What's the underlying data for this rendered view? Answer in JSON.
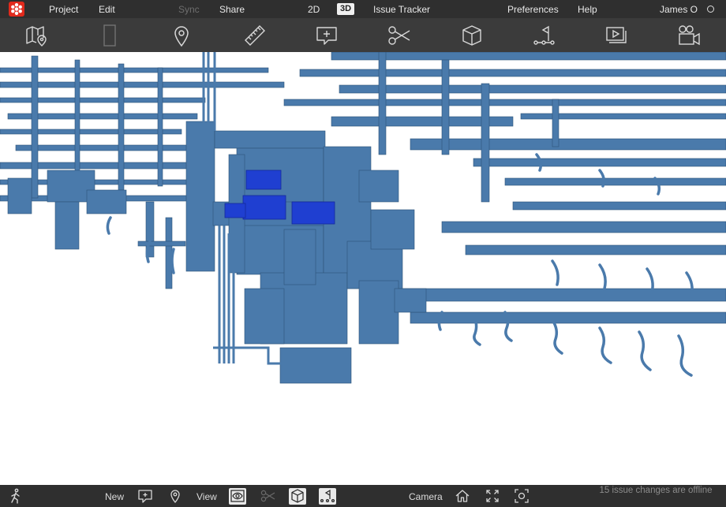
{
  "menu": {
    "project": "Project",
    "edit": "Edit",
    "sync": "Sync",
    "share": "Share",
    "view_2d": "2D",
    "view_3d": "3D",
    "issue_tracker": "Issue Tracker",
    "preferences": "Preferences",
    "help": "Help",
    "user_name": "James O"
  },
  "toolbar": {
    "tools": [
      "map-pin-icon",
      "door-icon",
      "location-pin-icon",
      "ruler-icon",
      "add-comment-icon",
      "scissors-icon",
      "cube-icon",
      "path-flag-icon",
      "media-icon",
      "video-camera-icon"
    ]
  },
  "bottombar": {
    "new_label": "New",
    "view_label": "View",
    "camera_label": "Camera",
    "status": "15 issue changes are offline"
  },
  "colors": {
    "bar_bg": "#2f2f2f",
    "toolbar_bg": "#3b3b3b",
    "model_pipe": "#4a7aab",
    "model_dark": "#2e5478",
    "selection": "#1f3fd1",
    "logo": "#e12a1c"
  }
}
